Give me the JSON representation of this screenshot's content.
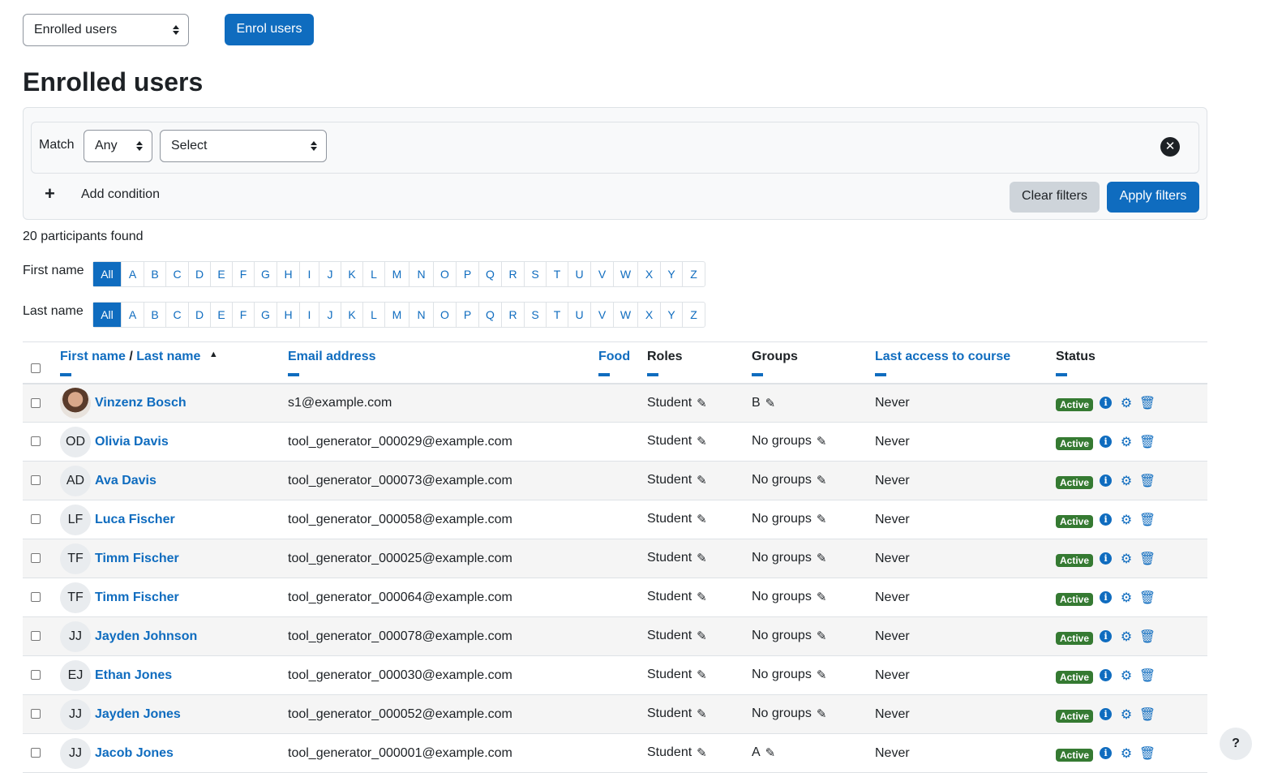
{
  "top": {
    "view_select": "Enrolled users",
    "enrol_button": "Enrol users"
  },
  "page_title": "Enrolled users",
  "filter": {
    "match_label": "Match",
    "match_value": "Any",
    "type_select": "Select",
    "add_condition": "Add condition",
    "clear": "Clear filters",
    "apply": "Apply filters"
  },
  "participants_count": "20 participants found",
  "initials": {
    "first_label": "First name",
    "last_label": "Last name",
    "all": "All",
    "letters": [
      "A",
      "B",
      "C",
      "D",
      "E",
      "F",
      "G",
      "H",
      "I",
      "J",
      "K",
      "L",
      "M",
      "N",
      "O",
      "P",
      "Q",
      "R",
      "S",
      "T",
      "U",
      "V",
      "W",
      "X",
      "Y",
      "Z"
    ]
  },
  "table": {
    "headers": {
      "first_name": "First name",
      "separator": "/",
      "last_name": "Last name",
      "email": "Email address",
      "food": "Food",
      "roles": "Roles",
      "groups": "Groups",
      "last_access": "Last access to course",
      "status": "Status"
    },
    "rows": [
      {
        "initials": "",
        "name": "Vinzenz Bosch",
        "email": "s1@example.com",
        "role": "Student",
        "groups": "B",
        "access": "Never",
        "status": "Active"
      },
      {
        "initials": "OD",
        "name": "Olivia Davis",
        "email": "tool_generator_000029@example.com",
        "role": "Student",
        "groups": "No groups",
        "access": "Never",
        "status": "Active"
      },
      {
        "initials": "AD",
        "name": "Ava Davis",
        "email": "tool_generator_000073@example.com",
        "role": "Student",
        "groups": "No groups",
        "access": "Never",
        "status": "Active"
      },
      {
        "initials": "LF",
        "name": "Luca Fischer",
        "email": "tool_generator_000058@example.com",
        "role": "Student",
        "groups": "No groups",
        "access": "Never",
        "status": "Active"
      },
      {
        "initials": "TF",
        "name": "Timm Fischer",
        "email": "tool_generator_000025@example.com",
        "role": "Student",
        "groups": "No groups",
        "access": "Never",
        "status": "Active"
      },
      {
        "initials": "TF",
        "name": "Timm Fischer",
        "email": "tool_generator_000064@example.com",
        "role": "Student",
        "groups": "No groups",
        "access": "Never",
        "status": "Active"
      },
      {
        "initials": "JJ",
        "name": "Jayden Johnson",
        "email": "tool_generator_000078@example.com",
        "role": "Student",
        "groups": "No groups",
        "access": "Never",
        "status": "Active"
      },
      {
        "initials": "EJ",
        "name": "Ethan Jones",
        "email": "tool_generator_000030@example.com",
        "role": "Student",
        "groups": "No groups",
        "access": "Never",
        "status": "Active"
      },
      {
        "initials": "JJ",
        "name": "Jayden Jones",
        "email": "tool_generator_000052@example.com",
        "role": "Student",
        "groups": "No groups",
        "access": "Never",
        "status": "Active"
      },
      {
        "initials": "JJ",
        "name": "Jacob Jones",
        "email": "tool_generator_000001@example.com",
        "role": "Student",
        "groups": "A",
        "access": "Never",
        "status": "Active"
      }
    ]
  },
  "help_label": "?"
}
